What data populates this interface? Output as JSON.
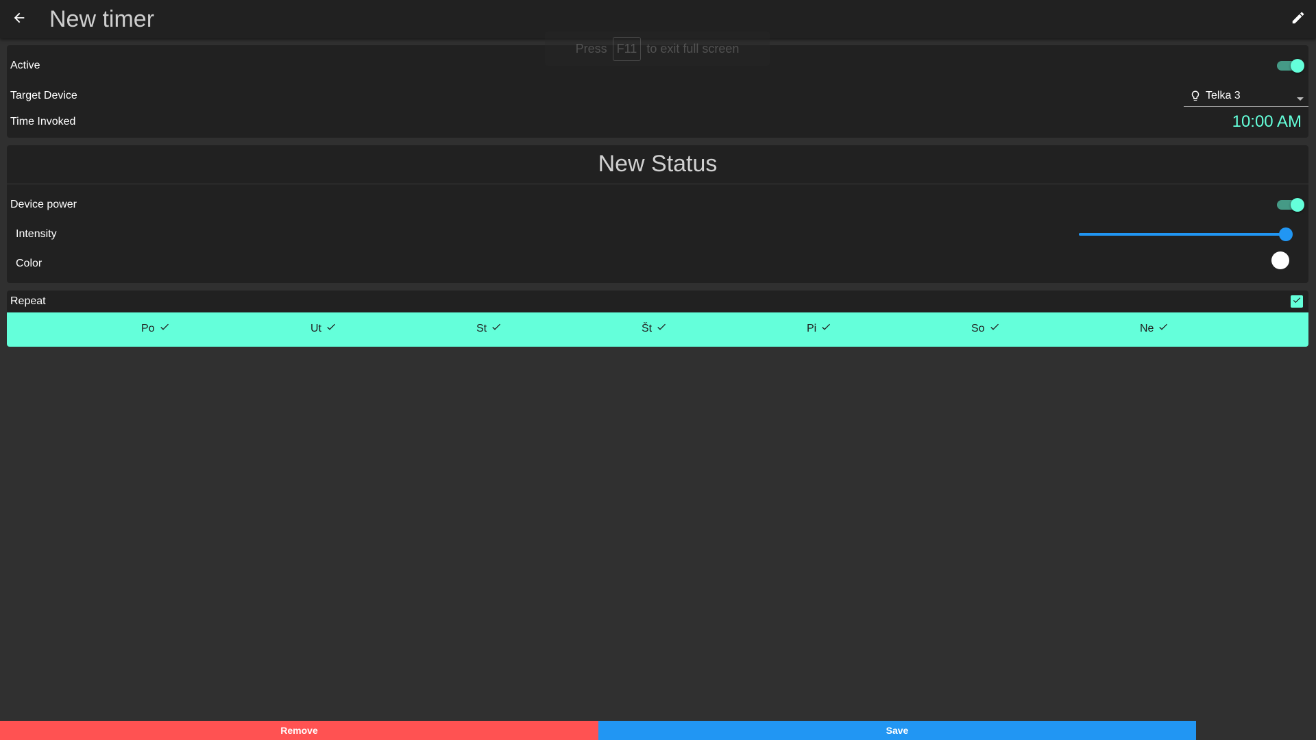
{
  "header": {
    "title": "New timer",
    "back_icon": "arrow-back-icon",
    "edit_icon": "pencil-icon"
  },
  "fullscreen_toast": {
    "prefix": "Press",
    "key": "F11",
    "suffix": "to exit full screen"
  },
  "settings": {
    "active_label": "Active",
    "active_on": true,
    "target_device_label": "Target Device",
    "target_device_value": "Telka 3",
    "time_invoked_label": "Time Invoked",
    "time_invoked_value": "10:00 AM"
  },
  "new_status": {
    "title": "New Status",
    "device_power_label": "Device power",
    "device_power_on": true,
    "intensity_label": "Intensity",
    "intensity_value": 1.0,
    "color_label": "Color",
    "color_value": "#ffffff"
  },
  "repeat": {
    "label": "Repeat",
    "checked": true,
    "days": [
      {
        "label": "Po",
        "checked": true
      },
      {
        "label": "Ut",
        "checked": true
      },
      {
        "label": "St",
        "checked": true
      },
      {
        "label": "Št",
        "checked": true
      },
      {
        "label": "Pi",
        "checked": true
      },
      {
        "label": "So",
        "checked": true
      },
      {
        "label": "Ne",
        "checked": true
      }
    ]
  },
  "actions": {
    "remove_label": "Remove",
    "save_label": "Save"
  },
  "colors": {
    "accent": "#64ffda",
    "primary": "#2196f3",
    "danger": "#ff5252",
    "background": "#303030",
    "card": "#212121"
  }
}
